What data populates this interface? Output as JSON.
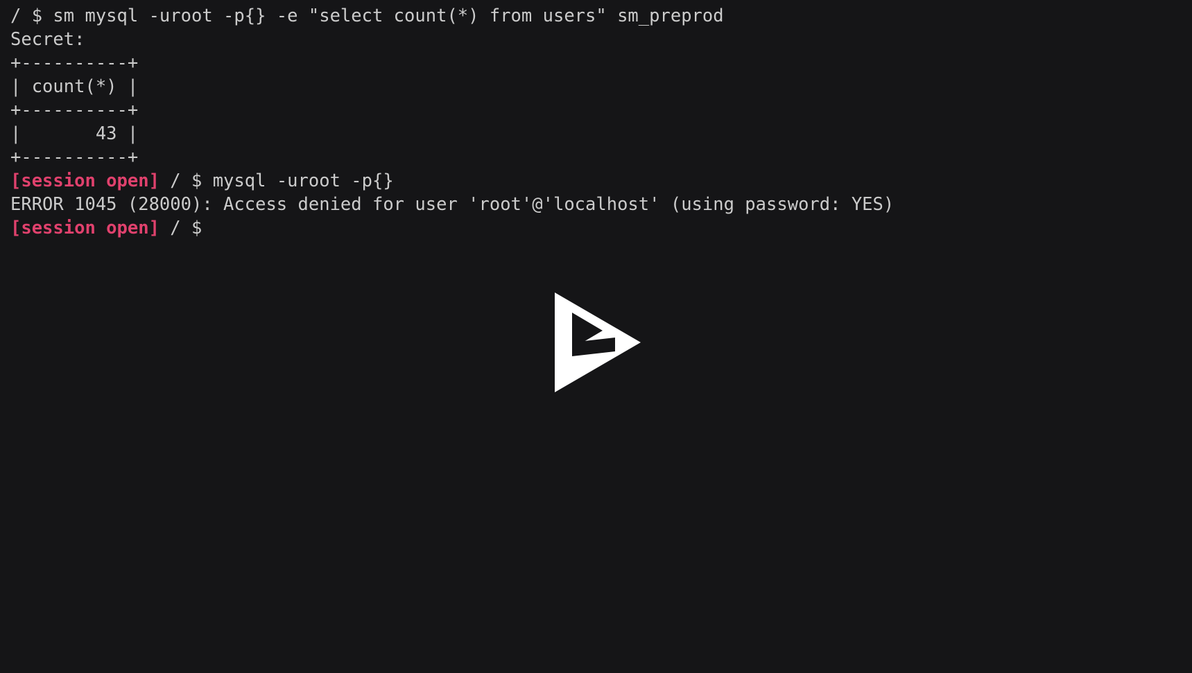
{
  "player": {
    "name": "asciinema-player",
    "state": "paused",
    "background_color": "#151517",
    "foreground_color": "#cbcbcb",
    "accent_color": "#e0416d",
    "overlay_icon": "play-logo-icon"
  },
  "terminal": {
    "prompt_symbol": "$",
    "cwd": "/",
    "lines": [
      {
        "id": "line-1",
        "text": "/ $ sm mysql -uroot -p{} -e \"select count(*) from users\" sm_preprod",
        "segments": [
          {
            "text": "/ $ sm mysql -uroot -p{} -e \"select count(*) from users\" sm_preprod",
            "color": "default"
          }
        ]
      },
      {
        "id": "line-2",
        "text": "Secret:",
        "segments": [
          {
            "text": "Secret:",
            "color": "default"
          }
        ]
      },
      {
        "id": "line-3",
        "text": "+----------+",
        "segments": [
          {
            "text": "+----------+",
            "color": "default"
          }
        ]
      },
      {
        "id": "line-4",
        "text": "| count(*) |",
        "segments": [
          {
            "text": "| count(*) |",
            "color": "default"
          }
        ]
      },
      {
        "id": "line-5",
        "text": "+----------+",
        "segments": [
          {
            "text": "+----------+",
            "color": "default"
          }
        ]
      },
      {
        "id": "line-6",
        "text": "|       43 |",
        "segments": [
          {
            "text": "|       43 |",
            "color": "default"
          }
        ]
      },
      {
        "id": "line-7",
        "text": "+----------+",
        "segments": [
          {
            "text": "+----------+",
            "color": "default"
          }
        ]
      },
      {
        "id": "line-8",
        "text": "[session open] / $ mysql -uroot -p{}",
        "segments": [
          {
            "text": "[session open]",
            "color": "accent"
          },
          {
            "text": " / $ mysql -uroot -p{}",
            "color": "default"
          }
        ]
      },
      {
        "id": "line-9",
        "text": "ERROR 1045 (28000): Access denied for user 'root'@'localhost' (using password: YES)",
        "segments": [
          {
            "text": "ERROR 1045 (28000): Access denied for user 'root'@'localhost' (using password: YES)",
            "color": "default"
          }
        ]
      },
      {
        "id": "line-10",
        "text": "[session open] / $ ",
        "segments": [
          {
            "text": "[session open]",
            "color": "accent"
          },
          {
            "text": " / $ ",
            "color": "default"
          }
        ]
      }
    ]
  },
  "query_result": {
    "column": "count(*)",
    "value": "43",
    "database": "sm_preprod"
  }
}
